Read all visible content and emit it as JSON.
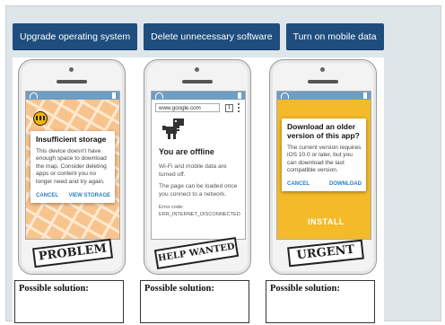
{
  "toolbar": {
    "buttons": [
      "Upgrade operating system",
      "Delete unnecessary software",
      "Turn on mobile data"
    ]
  },
  "phones": [
    {
      "dialog_title": "Insufficient storage",
      "dialog_body": "This device doesn't have enough space to download the map. Consider deleting apps or content you no longer need and try again.",
      "actions": [
        "CANCEL",
        "VIEW STORAGE"
      ],
      "stamp": "PROBLEM"
    },
    {
      "url": "www.google.com",
      "tabs_count": "1",
      "offline_title": "You are offline",
      "offline_text_1": "Wi-Fi and mobile data are turned off.",
      "offline_text_2": "The page can be loaded once you connect to a network.",
      "error_code": "Error code: ERR_INTERNET_DISCONNECTED",
      "stamp": "HELP WANTED"
    },
    {
      "dialog_title": "Download an older version of this app?",
      "dialog_body": "The current version requires iOS 10.0 or later, but you can download the last compatible version.",
      "actions": [
        "CANCEL",
        "DOWNLOAD"
      ],
      "button_behind": "INSTALL",
      "stamp": "URGENT"
    }
  ],
  "solution_label": "Possible solution:",
  "colors": {
    "toolbar_button": "#1f4e7e",
    "status_bar": "#6e9ec4",
    "map_bg": "#f8c48e",
    "app_store_bg": "#f4ba2a",
    "dialog_action": "#2a7fbf"
  }
}
